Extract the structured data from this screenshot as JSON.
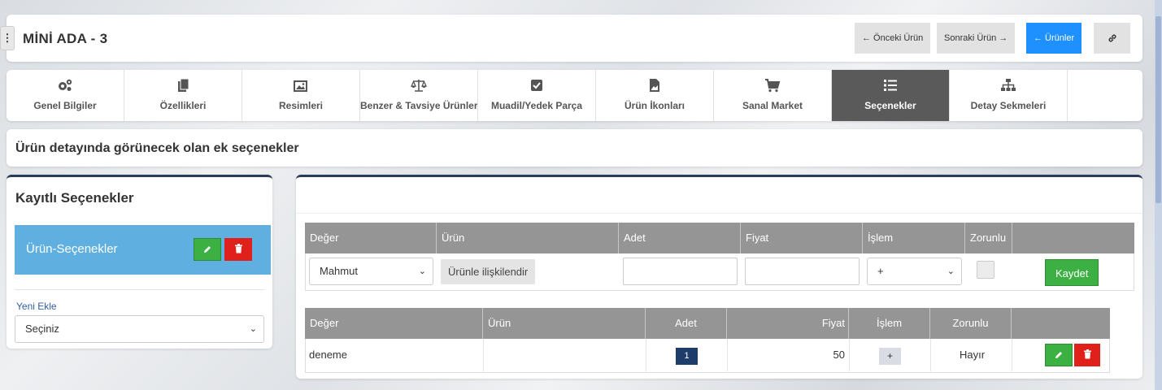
{
  "header": {
    "title": "MİNİ ADA - 3",
    "prev_label": "← Önceki Ürün",
    "next_label": "Sonraki Ürün →",
    "products_label": "← Ürünler"
  },
  "tabs": [
    {
      "label": "Genel Bilgiler",
      "icon": "cogs-icon"
    },
    {
      "label": "Özellikleri",
      "icon": "files-icon"
    },
    {
      "label": "Resimleri",
      "icon": "image-icon"
    },
    {
      "label": "Benzer & Tavsiye Ürünler",
      "icon": "balance-scale-icon"
    },
    {
      "label": "Muadil/Yedek Parça",
      "icon": "check-square-icon"
    },
    {
      "label": "Ürün İkonları",
      "icon": "file-image-icon"
    },
    {
      "label": "Sanal Market",
      "icon": "cart-icon"
    },
    {
      "label": "Seçenekler",
      "icon": "list-icon",
      "active": true
    },
    {
      "label": "Detay Sekmeleri",
      "icon": "sitemap-icon"
    }
  ],
  "section_title": "Ürün detayında görünecek olan ek seçenekler",
  "left_panel": {
    "title": "Kayıtlı Seçenekler",
    "item_label": "Ürün-Seçenekler",
    "new_label": "Yeni Ekle",
    "select_value": "Seçiniz"
  },
  "form": {
    "headers": [
      "Değer",
      "Ürün",
      "Adet",
      "Fiyat",
      "İşlem",
      "Zorunlu",
      ""
    ],
    "value_select": "Mahmut",
    "relate_button": "Ürünle ilişkilendir",
    "adet": "",
    "fiyat": "",
    "islem_select": "+",
    "save_label": "Kaydet"
  },
  "table": {
    "headers": [
      "Değer",
      "Ürün",
      "Adet",
      "Fiyat",
      "İşlem",
      "Zorunlu",
      ""
    ],
    "rows": [
      {
        "deger": "deneme",
        "urun": "",
        "adet": "1",
        "fiyat": "50",
        "islem": "+",
        "zorunlu": "Hayır"
      }
    ]
  },
  "colors": {
    "accent_blue": "#1e90ff",
    "active_tab": "#5a5a5a",
    "option_item": "#5fb0e0",
    "grid_header": "#959595",
    "edit_green": "#3cb043",
    "delete_red": "#e0201a",
    "badge_navy": "#1d3c6a"
  }
}
